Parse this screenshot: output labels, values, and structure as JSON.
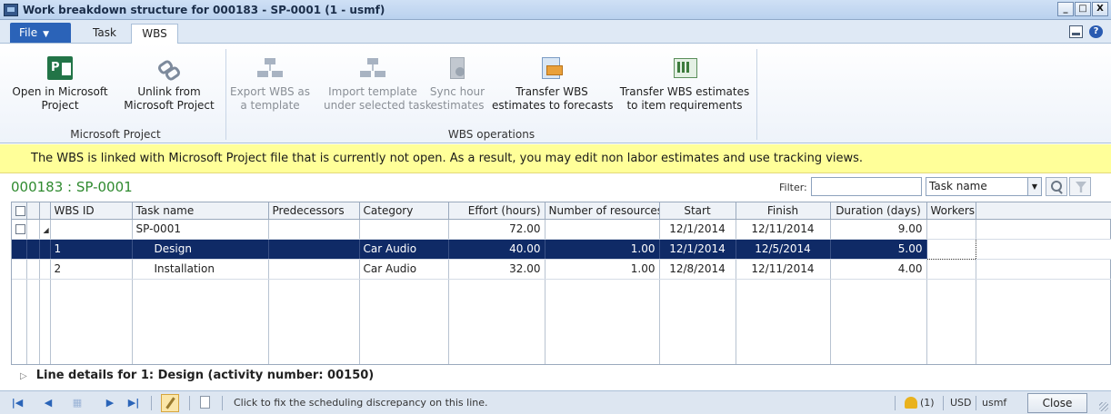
{
  "window": {
    "title": "Work breakdown structure for 000183 - SP-0001 (1 - usmf)",
    "min": "_",
    "max": "□",
    "close": "X"
  },
  "tabs": {
    "file": "File",
    "task": "Task",
    "wbs": "WBS",
    "help": "?"
  },
  "ribbon": {
    "open_project": "Open in Microsoft\nProject",
    "unlink_project": "Unlink from\nMicrosoft Project",
    "group_ms_project": "Microsoft Project",
    "export_wbs": "Export WBS as\na template",
    "import_template": "Import template\nunder selected task",
    "sync_hour": "Sync hour\nestimates",
    "transfer_forecasts": "Transfer WBS\nestimates to forecasts",
    "transfer_items": "Transfer WBS estimates\nto item requirements",
    "group_wbs_ops": "WBS operations"
  },
  "message": "The WBS is linked with Microsoft Project file that is currently not open.  As a result, you may edit non labor estimates and use tracking views.",
  "header": {
    "doc_id": "000183 : SP-0001",
    "filter_label": "Filter:",
    "filter_value": "",
    "filter_field": "Task name"
  },
  "grid": {
    "columns": [
      "WBS ID",
      "Task name",
      "Predecessors",
      "Category",
      "Effort (hours)",
      "Number of resources",
      "Start",
      "Finish",
      "Duration (days)",
      "Workers"
    ],
    "rows": [
      {
        "wbs_id": "",
        "task": "SP-0001",
        "pred": "",
        "category": "",
        "effort": "72.00",
        "resources": "",
        "start": "12/1/2014",
        "finish": "12/11/2014",
        "duration": "9.00",
        "workers": ""
      },
      {
        "wbs_id": "1",
        "task": "Design",
        "pred": "",
        "category": "Car Audio",
        "effort": "40.00",
        "resources": "1.00",
        "start": "12/1/2014",
        "finish": "12/5/2014",
        "duration": "5.00",
        "workers": ""
      },
      {
        "wbs_id": "2",
        "task": "Installation",
        "pred": "",
        "category": "Car Audio",
        "effort": "32.00",
        "resources": "1.00",
        "start": "12/8/2014",
        "finish": "12/11/2014",
        "duration": "4.00",
        "workers": ""
      }
    ]
  },
  "line_details": "Line details for 1: Design (activity number: 00150)",
  "status": {
    "message": "Click to fix the scheduling discrepancy on this line.",
    "alerts": "(1)",
    "currency": "USD",
    "company": "usmf",
    "close": "Close"
  }
}
